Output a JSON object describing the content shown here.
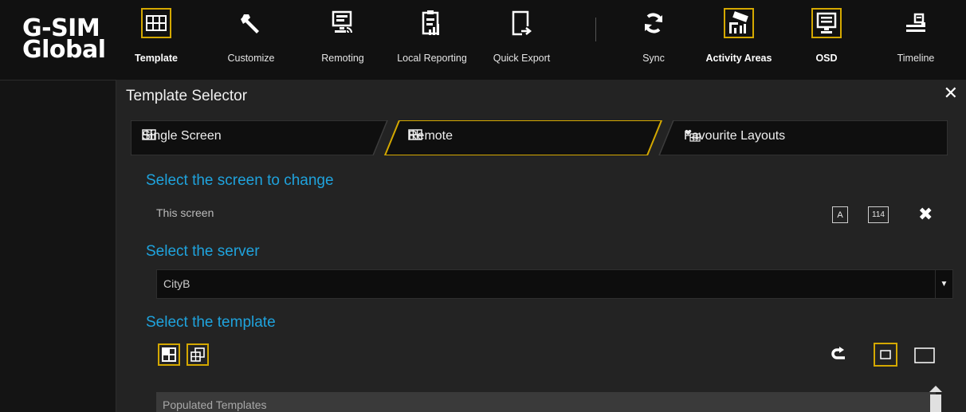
{
  "brand": {
    "line1": "G-SIM",
    "line2": "Global"
  },
  "toolbar": {
    "items": [
      {
        "label": "Template",
        "icon": "grid-layout-icon",
        "active": true
      },
      {
        "label": "Customize",
        "icon": "wrench-icon",
        "active": false
      },
      {
        "label": "Remoting",
        "icon": "remote-monitor-icon",
        "active": false
      },
      {
        "label": "Local Reporting",
        "icon": "clipboard-report-icon",
        "active": false
      },
      {
        "label": "Quick Export",
        "icon": "export-icon",
        "active": false
      },
      {
        "label": "Sync",
        "icon": "sync-icon",
        "active": false
      },
      {
        "label": "Activity Areas",
        "icon": "camera-area-icon",
        "active": true
      },
      {
        "label": "OSD",
        "icon": "monitor-osd-icon",
        "active": true
      },
      {
        "label": "Timeline",
        "icon": "timeline-icon",
        "active": false
      }
    ]
  },
  "dialog": {
    "title": "Template Selector",
    "close_icon": "close-icon",
    "tabs": [
      {
        "label": "Single Screen",
        "icon": "grid-layout-icon",
        "active": false
      },
      {
        "label": "Remote",
        "icon": "grid-layout-icon",
        "active": true
      },
      {
        "label": "Favourite Layouts",
        "icon": "heart-grid-icon",
        "active": false
      }
    ],
    "screen_section": {
      "heading": "Select the screen to change",
      "current": "This screen",
      "btn_a": "A",
      "btn_num": "114"
    },
    "server_section": {
      "heading": "Select the server",
      "selected": "CityB"
    },
    "template_section": {
      "heading": "Select the template",
      "list_header": "Populated Templates"
    }
  },
  "colors": {
    "accent": "#d4a800",
    "heading": "#1fa3dd",
    "background": "#232323",
    "toolbar": "#111111"
  }
}
